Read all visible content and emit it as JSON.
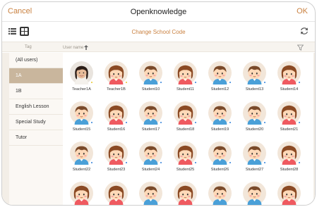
{
  "header": {
    "cancel_label": "Cancel",
    "title": "Openknowledge",
    "ok_label": "OK"
  },
  "toolbar": {
    "change_code_label": "Change School Code",
    "view_modes": [
      "list-view-icon",
      "grid-view-icon"
    ],
    "active_view": "grid"
  },
  "columns": {
    "tag_label": "Tag",
    "username_label": "User name"
  },
  "tags": [
    {
      "label": "(All users)",
      "selected": false
    },
    {
      "label": "1A",
      "selected": true
    },
    {
      "label": "1B",
      "selected": false
    },
    {
      "label": "English Lesson",
      "selected": false
    },
    {
      "label": "Special Study",
      "selected": false
    },
    {
      "label": "Tutor",
      "selected": false
    }
  ],
  "users": [
    {
      "name": "Teacher1A",
      "avatar": "photo",
      "status": "yellow"
    },
    {
      "name": "Teacher1B",
      "avatar": "girl",
      "status": "yellow"
    },
    {
      "name": "Student10",
      "avatar": "boy",
      "status": "blue"
    },
    {
      "name": "Student11",
      "avatar": "girl",
      "status": "blue"
    },
    {
      "name": "Student12",
      "avatar": "boy",
      "status": "blue"
    },
    {
      "name": "Student13",
      "avatar": "boy",
      "status": "blue"
    },
    {
      "name": "Student14",
      "avatar": "girl",
      "status": "blue"
    },
    {
      "name": "Student15",
      "avatar": "boy",
      "status": "blue"
    },
    {
      "name": "Student16",
      "avatar": "girl",
      "status": "blue"
    },
    {
      "name": "Student17",
      "avatar": "boy",
      "status": "blue"
    },
    {
      "name": "Student18",
      "avatar": "girl",
      "status": "blue"
    },
    {
      "name": "Student19",
      "avatar": "boy",
      "status": "blue"
    },
    {
      "name": "Student20",
      "avatar": "boy",
      "status": "blue"
    },
    {
      "name": "Student21",
      "avatar": "girl",
      "status": "blue"
    },
    {
      "name": "Student22",
      "avatar": "boy",
      "status": "blue"
    },
    {
      "name": "Student23",
      "avatar": "girl",
      "status": "blue"
    },
    {
      "name": "Student24",
      "avatar": "boy",
      "status": "blue"
    },
    {
      "name": "Student25",
      "avatar": "girl",
      "status": "blue"
    },
    {
      "name": "Student26",
      "avatar": "boy",
      "status": "blue"
    },
    {
      "name": "Student27",
      "avatar": "boy",
      "status": "blue"
    },
    {
      "name": "Student28",
      "avatar": "girl",
      "status": "blue"
    },
    {
      "name": "",
      "avatar": "girl",
      "status": ""
    },
    {
      "name": "",
      "avatar": "girl",
      "status": ""
    },
    {
      "name": "",
      "avatar": "boy",
      "status": ""
    },
    {
      "name": "",
      "avatar": "girl",
      "status": ""
    },
    {
      "name": "",
      "avatar": "boy",
      "status": ""
    },
    {
      "name": "",
      "avatar": "boy",
      "status": ""
    },
    {
      "name": "",
      "avatar": "girl",
      "status": ""
    }
  ],
  "colors": {
    "accent": "#c9803f",
    "selected_tag": "#c9b69d",
    "status_yellow": "#e8c829",
    "status_blue": "#2f7fd8",
    "sidebar_bg": "#f3eee7"
  }
}
